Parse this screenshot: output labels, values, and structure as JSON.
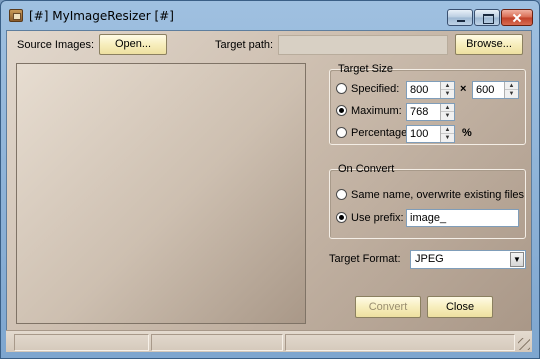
{
  "window": {
    "title": "[#] MyImageResizer [#]"
  },
  "source": {
    "label": "Source Images:",
    "open_button": "Open..."
  },
  "target": {
    "label": "Target path:",
    "path_value": "",
    "browse_button": "Browse..."
  },
  "target_size": {
    "title": "Target Size",
    "specified": {
      "label": "Specified:",
      "checked": false,
      "width": "800",
      "height": "600",
      "times": "×"
    },
    "maximum": {
      "label": "Maximum:",
      "checked": true,
      "value": "768"
    },
    "percentage": {
      "label": "Percentage:",
      "checked": false,
      "value": "100",
      "unit": "%"
    }
  },
  "on_convert": {
    "title": "On Convert",
    "same_name": {
      "label": "Same name, overwrite existing files",
      "checked": false
    },
    "use_prefix": {
      "label": "Use prefix:",
      "checked": true,
      "value": "image_"
    }
  },
  "target_format": {
    "label": "Target Format:",
    "selected": "JPEG"
  },
  "actions": {
    "convert": "Convert",
    "close": "Close"
  },
  "colors": {
    "titlebar": "#8fb3da",
    "client_light": "#e2d8cd",
    "client_dark": "#a89686",
    "button_face": "#f7eebd"
  },
  "icons": {
    "app": "app-icon",
    "minimize": "minimize-icon",
    "maximize": "maximize-icon",
    "close": "close-icon"
  }
}
